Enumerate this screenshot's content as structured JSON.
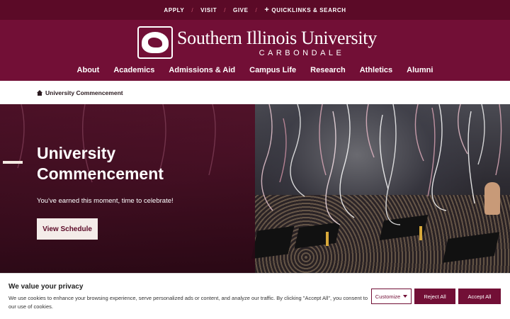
{
  "utility": {
    "apply": "APPLY",
    "visit": "VISIT",
    "give": "GIVE",
    "quicklinks": "QUICKLINKS & SEARCH",
    "sep": "/"
  },
  "logo": {
    "name": "Southern Illinois University",
    "campus": "CARBONDALE"
  },
  "nav": [
    "About",
    "Academics",
    "Admissions & Aid",
    "Campus Life",
    "Research",
    "Athletics",
    "Alumni"
  ],
  "breadcrumb": {
    "current": "University Commencement"
  },
  "hero": {
    "title": "University Commencement",
    "subtitle": "You've earned this moment, time to celebrate!",
    "button": "View Schedule"
  },
  "cookie": {
    "title": "We value your privacy",
    "text": "We use cookies to enhance your browsing experience, serve personalized ads or content, and analyze our traffic. By clicking \"Accept All\", you consent to our use of cookies.",
    "customize": "Customize",
    "reject": "Reject All",
    "accept": "Accept All"
  },
  "colors": {
    "maroon": "#720f36",
    "maroon_dark": "#5b0a27"
  }
}
